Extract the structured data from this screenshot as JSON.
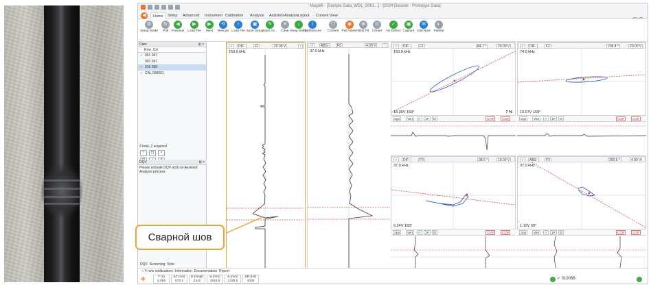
{
  "app": {
    "title": "Magnifi - [Sample Data_WDL_0001...] - [2024 Dataset - Prototype Data]",
    "tabs": [
      "Home",
      "Setup",
      "Advanced",
      "Instrument",
      "Calibration",
      "Analysis",
      "Assisted Analysis",
      "Layout",
      "Current View"
    ],
    "active_tab": "Home",
    "ribbon": [
      {
        "name": "setup-mode",
        "label": "Setup Mode",
        "icon": "setup-mode-icon",
        "color": "#9aa3ab"
      },
      {
        "name": "pull",
        "label": "Pull",
        "icon": "pull-icon",
        "color": "#9aa3ab"
      },
      {
        "name": "previous",
        "label": "Previous",
        "icon": "previous-icon",
        "color": "#3aa845"
      },
      {
        "name": "load-file",
        "label": "Load File",
        "icon": "load-file-icon",
        "color": "#3aa845"
      },
      {
        "name": "next",
        "label": "Next",
        "icon": "next-icon",
        "color": "#3aa845"
      },
      {
        "name": "rescan",
        "label": "Rescan",
        "icon": "rescan-icon",
        "color": "#2a7fd0"
      },
      {
        "name": "load-file-2",
        "label": "Load File",
        "icon": "upload-icon",
        "color": "#2a7fd0"
      },
      {
        "name": "save-setup",
        "label": "Save Setup",
        "icon": "save-setup-icon",
        "color": "#2a7fd0"
      },
      {
        "name": "save-as",
        "label": "Save As...",
        "icon": "save-as-icon",
        "color": "#3aa845"
      },
      {
        "name": "clear",
        "label": "Clear",
        "icon": "clear-icon",
        "color": "#9aa3ab"
      },
      {
        "name": "keep-setup",
        "label": "Keep Setup",
        "icon": "keep-setup-icon",
        "color": "#3aa845"
      },
      {
        "name": "preferences",
        "label": "Preferences",
        "icon": "info-icon",
        "color": "#2a7fd0"
      },
      {
        "name": "content",
        "label": "Content",
        "icon": "content-icon",
        "color": "#9aa3ab"
      },
      {
        "name": "pull-advert",
        "label": "Pull Advert",
        "icon": "pull-advert-icon",
        "color": "#e8772a"
      },
      {
        "name": "best-fit",
        "label": "Best Fit",
        "icon": "best-fit-icon",
        "color": "#9aa3ab"
      },
      {
        "name": "center",
        "label": "Center",
        "icon": "center-icon",
        "color": "#9aa3ab"
      },
      {
        "name": "no-defect",
        "label": "No Defect",
        "icon": "no-defect-icon",
        "color": "#3aa845"
      },
      {
        "name": "capture",
        "label": "Capture",
        "icon": "capture-icon",
        "color": "#3aa845"
      },
      {
        "name": "add-note",
        "label": "Add Note",
        "icon": "add-note-icon",
        "color": "#2a7fd0"
      },
      {
        "name": "palette",
        "label": "Palette",
        "icon": "palette-icon",
        "color": "#9aa3ab"
      }
    ]
  },
  "left_panel": {
    "header": "Data",
    "columns": [
      "Row",
      "Col"
    ],
    "rows": [
      {
        "label": "001  047",
        "checked": true,
        "selected": false
      },
      {
        "label": "001  047",
        "checked": false,
        "selected": false
      },
      {
        "label": "016  058",
        "checked": true,
        "selected": true
      },
      {
        "label": "CAL 099001",
        "checked": true,
        "selected": false
      }
    ],
    "count_text": "2 total, 2 acquired",
    "dqv_header": "DQV",
    "dqv_message": "Please activate DQV and run Assisted Analysis process",
    "bottom_tabs": [
      "DQV",
      "Screening",
      "Note"
    ]
  },
  "strips": [
    {
      "name": "strip-1",
      "channel": "DIF-",
      "chan_num": "F1",
      "volts": "20.00 V",
      "freq": "150.0 kHz",
      "highlighted": true
    },
    {
      "name": "strip-2",
      "channel": "ABS-",
      "chan_num": "F3",
      "volts": "4.00 V",
      "freq": "37.0 kHz",
      "highlighted": false
    }
  ],
  "lissajous": [
    {
      "name": "liss-1",
      "channel": "DIF-",
      "chan_num": "F1",
      "angle": "84.1 °",
      "volts": "20.00 V",
      "freq": "150.0 kHz",
      "reading": "18.35V 159°",
      "pct": "? %"
    },
    {
      "name": "liss-2",
      "channel": "DIF-",
      "chan_num": "F2",
      "angle": "206.4 °",
      "volts": "20.00 V",
      "freq": "74.0 kHz",
      "reading": "10.07V 169°",
      "pct": ""
    },
    {
      "name": "liss-3",
      "channel": "DIF-",
      "chan_num": "F3",
      "angle": "38.5 °",
      "volts": "10.00 V",
      "freq": "37.0 kHz",
      "reading": "6.24V 183°",
      "pct": ""
    },
    {
      "name": "liss-4",
      "channel": "ABS-",
      "chan_num": "F3",
      "angle": "200.6 °",
      "volts": "4.00 V",
      "freq": "37.0 kHz",
      "reading": "1.10V 30°",
      "pct": ""
    }
  ],
  "mini_bar": {
    "vert": "Vpp",
    "hor": "Vert",
    "opt1": "1P",
    "opt2": "M",
    "cor_label": "COR"
  },
  "status": {
    "notifications": "4 new notifications",
    "links": [
      "Information",
      "Documentation",
      "Report"
    ],
    "fields": [
      {
        "label": "T (s)",
        "value": "2.056"
      },
      {
        "label": "ΔT (ms)",
        "value": "578.2"
      },
      {
        "label": "D (smpl)",
        "value": "4241"
      },
      {
        "label": "Δ (mm)",
        "value": "4515.5"
      },
      {
        "label": "Δ (mm)",
        "value": "1338.5"
      },
      {
        "label": "ΔR (Hz)",
        "value": "4000"
      }
    ],
    "counter": "✓ 019068"
  },
  "callout": {
    "text": "Сварной шов"
  },
  "colors": {
    "accent": "#e8a33a",
    "selection": "#c9dcf3",
    "signal": "#2f5fc8",
    "reference": "#d9463b"
  }
}
